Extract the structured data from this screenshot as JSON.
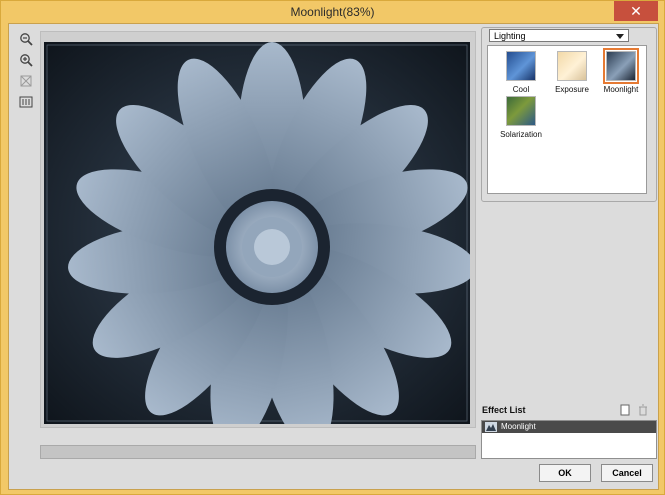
{
  "window": {
    "title": "Moonlight(83%)",
    "close_glyph": "✕"
  },
  "toolbar": [
    {
      "name": "zoom-out-icon"
    },
    {
      "name": "zoom-in-icon"
    },
    {
      "name": "fit-to-window-icon"
    },
    {
      "name": "actual-size-icon"
    }
  ],
  "lighting_select": {
    "value": "Lighting"
  },
  "effects": [
    {
      "label": "Cool"
    },
    {
      "label": "Exposure"
    },
    {
      "label": "Moonlight"
    },
    {
      "label": "Solarization"
    }
  ],
  "effect_list": {
    "title": "Effect List",
    "items": [
      {
        "label": "Moonlight"
      }
    ]
  },
  "buttons": {
    "ok": "OK",
    "cancel": "Cancel"
  },
  "colors": {
    "accent": "#e67a33",
    "title_bar": "#f2c867",
    "close": "#c7503d"
  }
}
